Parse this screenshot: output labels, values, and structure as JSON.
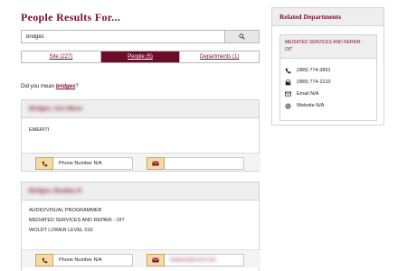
{
  "page": {
    "title": "People Results For..."
  },
  "search": {
    "value": "bridges",
    "button_icon": "search-icon"
  },
  "tabs": [
    {
      "label": "Site (227)",
      "active": false
    },
    {
      "label": "People (5)",
      "active": true
    },
    {
      "label": "Departments (1)",
      "active": false
    }
  ],
  "suggestion": {
    "prefix": "Did you mean ",
    "term": "bridges",
    "suffix": "?"
  },
  "people": [
    {
      "name": "Bridges, Ann Marie",
      "details": [
        "EMERITI"
      ],
      "phone": "Phone Number N/A",
      "email": ""
    },
    {
      "name": "Bridges, Bradley R",
      "details": [
        "AUDIO/VISUAL PROGRAMMER",
        "MEDIATED SERVICES AND REPAIR - OIT",
        "WOLDT LOWER LEVEL 010"
      ],
      "phone": "Phone Number N/A",
      "email": "bridg1br@cmich.edu"
    }
  ],
  "sidebar": {
    "title": "Related Departments",
    "department": {
      "name": "MEDIATED SERVICES AND REPAIR - OIT",
      "phone": "(989) 774-3891",
      "fax": "(989) 774-1210",
      "email": "Email N/A",
      "website": "Website N/A"
    }
  },
  "colors": {
    "brand": "#6d0b2a",
    "link": "#7a0f2b",
    "icon_bg": "#f6d9a4"
  }
}
